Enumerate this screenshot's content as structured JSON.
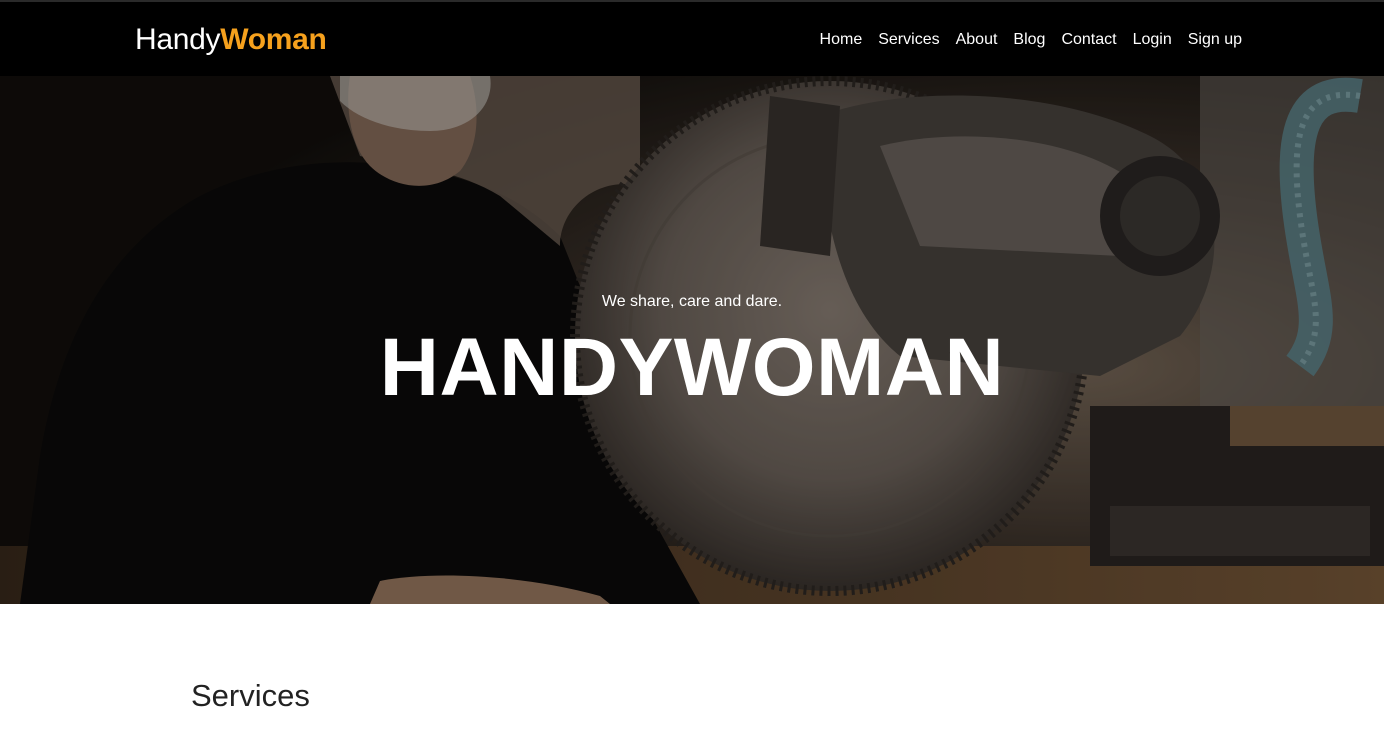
{
  "brand": {
    "part1": "Handy",
    "part2": "Woman"
  },
  "nav": {
    "items": [
      {
        "label": "Home"
      },
      {
        "label": "Services"
      },
      {
        "label": "About"
      },
      {
        "label": "Blog"
      },
      {
        "label": "Contact"
      },
      {
        "label": "Login"
      },
      {
        "label": "Sign up"
      }
    ]
  },
  "hero": {
    "tagline": "We share, care and dare.",
    "title": "HANDYWOMAN",
    "image": "woman-using-miter-saw-photo"
  },
  "services": {
    "heading": "Services"
  },
  "colors": {
    "accent": "#f6a11d",
    "navbar": "#000000"
  }
}
